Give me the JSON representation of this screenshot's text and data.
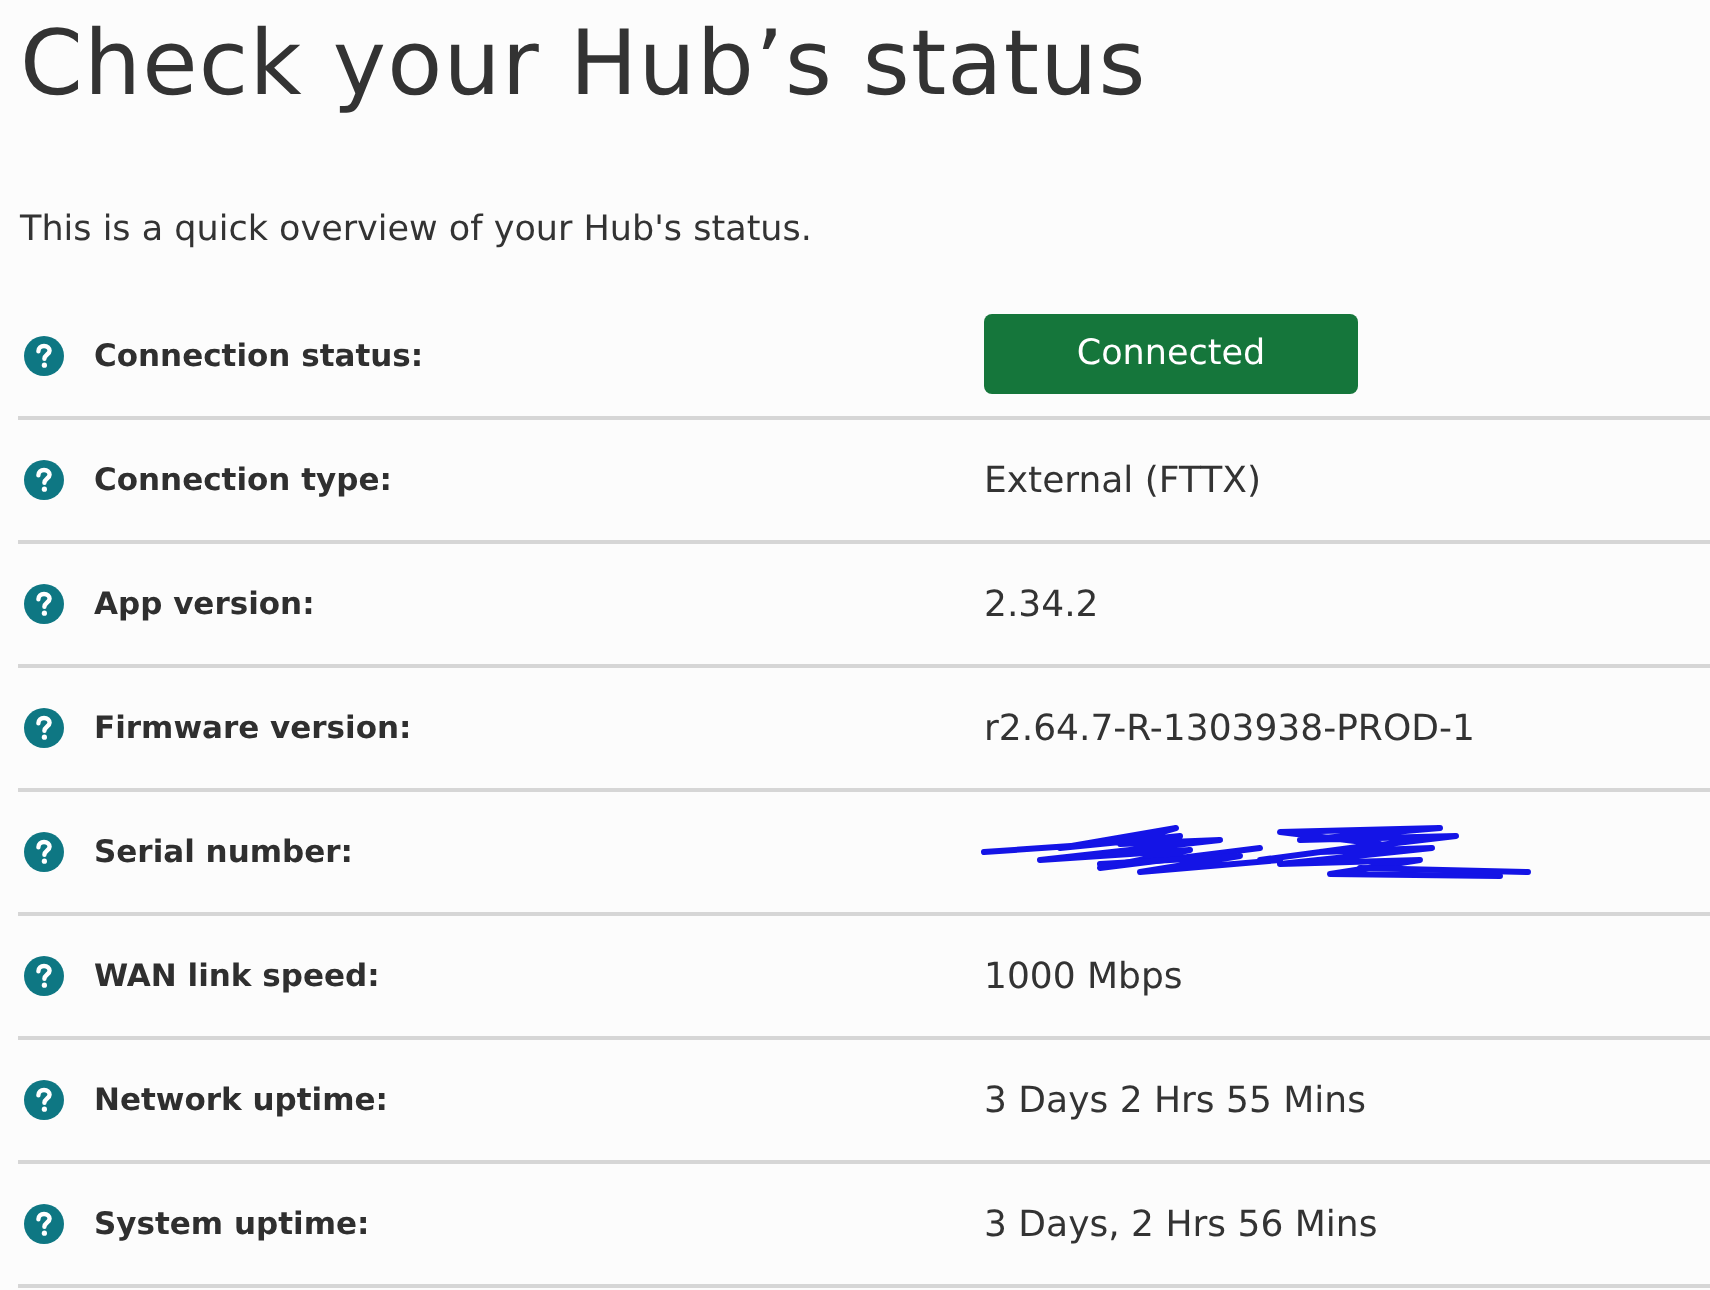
{
  "page": {
    "title": "Check your Hub’s status",
    "intro": "This is a quick overview of your Hub's status."
  },
  "rows": [
    {
      "label": "Connection status:",
      "kind": "badge",
      "value": "Connected"
    },
    {
      "label": "Connection type:",
      "kind": "text",
      "value": "External (FTTX)"
    },
    {
      "label": "App version:",
      "kind": "text",
      "value": "2.34.2"
    },
    {
      "label": "Firmware version:",
      "kind": "text",
      "value": "r2.64.7-R-1303938-PROD-1"
    },
    {
      "label": "Serial number:",
      "kind": "redacted"
    },
    {
      "label": "WAN link speed:",
      "kind": "text",
      "value": "1000 Mbps"
    },
    {
      "label": "Network uptime:",
      "kind": "text",
      "value": "3 Days 2 Hrs 55 Mins"
    },
    {
      "label": "System uptime:",
      "kind": "text",
      "value": "3 Days, 2 Hrs 56 Mins"
    }
  ]
}
